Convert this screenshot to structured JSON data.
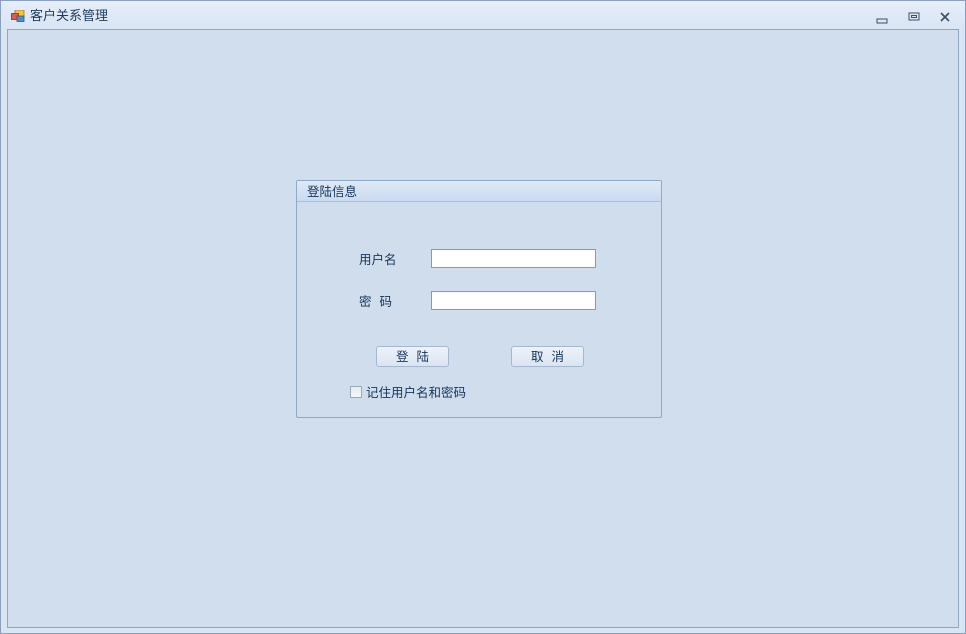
{
  "window": {
    "title": "客户关系管理",
    "app_icon": "app-window-icon",
    "controls": {
      "minimize_icon": "minimize-icon",
      "restore_icon": "restore-icon",
      "close_icon": "close-icon"
    }
  },
  "login_group": {
    "title": "登陆信息",
    "username_label": "用户名",
    "username_value": "",
    "password_label": "密  码",
    "password_value": "",
    "login_button": "登  陆",
    "cancel_button": "取  消",
    "remember_checkbox_label": "记住用户名和密码",
    "remember_checked": false
  },
  "colors": {
    "client_background": "#d0deee",
    "title_text": "#1e3a5c",
    "group_border": "#8ea8c8"
  }
}
